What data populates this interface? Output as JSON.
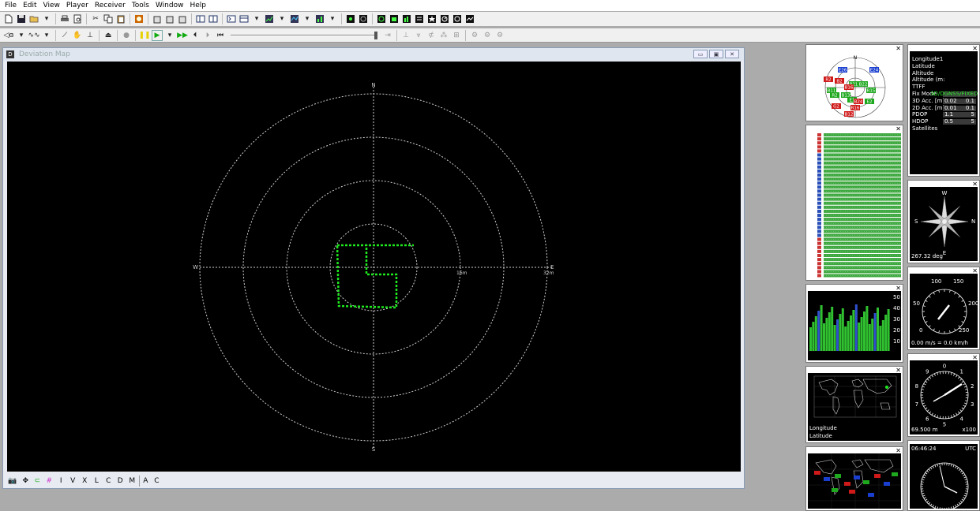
{
  "menu": [
    "File",
    "Edit",
    "View",
    "Player",
    "Receiver",
    "Tools",
    "Window",
    "Help"
  ],
  "toolbar2": {
    "ind_label": "I",
    "v_label": "V",
    "x_label": "X",
    "l_label": "L",
    "c_label": "C",
    "d_label": "D",
    "m_label": "M",
    "a_label": "A",
    "c2_label": "C"
  },
  "window": {
    "title": "Deviation Map"
  },
  "map": {
    "north": "N",
    "south": "S",
    "east": "E",
    "west": "W",
    "ring1_label": "16m",
    "ring2_label": "32m",
    "track_color": "#1ee81e",
    "grid_color": "#cfcfcf"
  },
  "status": {
    "bar_labels": [
      "I",
      "V",
      "X",
      "L",
      "C",
      "D",
      "M",
      "A",
      "C"
    ]
  },
  "sky": {
    "north": "N",
    "sats": [
      {
        "id": "E26",
        "color": "#1a3fd0"
      },
      {
        "id": "E24",
        "color": "#1a3fd0"
      },
      {
        "id": "R2",
        "color": "#d01a1a"
      },
      {
        "id": "B2",
        "color": "#d01a1a"
      },
      {
        "id": "B21",
        "color": "#1ea81e"
      },
      {
        "id": "B16",
        "color": "#d01a1a"
      },
      {
        "id": "B22",
        "color": "#1ea81e"
      },
      {
        "id": "B11",
        "color": "#1ea81e"
      },
      {
        "id": "R15",
        "color": "#1ea81e"
      },
      {
        "id": "R2",
        "color": "#1ea81e"
      },
      {
        "id": "B13",
        "color": "#1ea81e"
      },
      {
        "id": "E1",
        "color": "#1ea81e"
      },
      {
        "id": "B24",
        "color": "#d01a1a"
      },
      {
        "id": "E2",
        "color": "#1ea81e"
      },
      {
        "id": "G2",
        "color": "#d01a1a"
      },
      {
        "id": "R16",
        "color": "#d01a1a"
      },
      {
        "id": "B12",
        "color": "#d01a1a"
      }
    ]
  },
  "info": {
    "rows": [
      {
        "label": "Longitude1",
        "v1": "",
        "v2": ""
      },
      {
        "label": "Latitude",
        "v1": "",
        "v2": ""
      },
      {
        "label": "Altitude",
        "v1": "",
        "v2": ""
      },
      {
        "label": "Altitude (m:",
        "v1": "",
        "v2": ""
      },
      {
        "label": "TTFF",
        "v1": "",
        "v2": ""
      },
      {
        "label": "Fix Mode",
        "v1": "3D/DGNSS/FIXED",
        "v2": ""
      },
      {
        "label": "3D Acc. [m]",
        "v1": "0.02",
        "v2": "0.1"
      },
      {
        "label": "2D Acc. [m]",
        "v1": "0.01",
        "v2": "0.1"
      },
      {
        "label": "PDOP",
        "v1": "1.1",
        "v2": "5"
      },
      {
        "label": "HDOP",
        "v1": "0.5",
        "v2": "5"
      },
      {
        "label": "Satellites",
        "v1": "",
        "v2": ""
      }
    ],
    "fix_color": "#2ee82e"
  },
  "compass": {
    "north": "W",
    "south": "E",
    "west": "S",
    "east": "N",
    "heading": "267.32 deg"
  },
  "speed": {
    "ticks": [
      "100",
      "150",
      "50",
      "200",
      "0",
      "250"
    ],
    "readout": "0.00 m/s = 0.0 km/h"
  },
  "altimeter": {
    "ticks": [
      "0",
      "9",
      "1",
      "8",
      "2",
      "7",
      "3",
      "6",
      "4",
      "5"
    ],
    "readout": "69.500 m",
    "multiplier": "x100"
  },
  "worldmap": {
    "lon_label": "Longitude",
    "lat_label": "Latitude"
  },
  "clock": {
    "time": "06:46:24",
    "zone": "UTC"
  },
  "bars": {
    "y_ticks": [
      "50",
      "40",
      "30",
      "20",
      "10"
    ]
  }
}
